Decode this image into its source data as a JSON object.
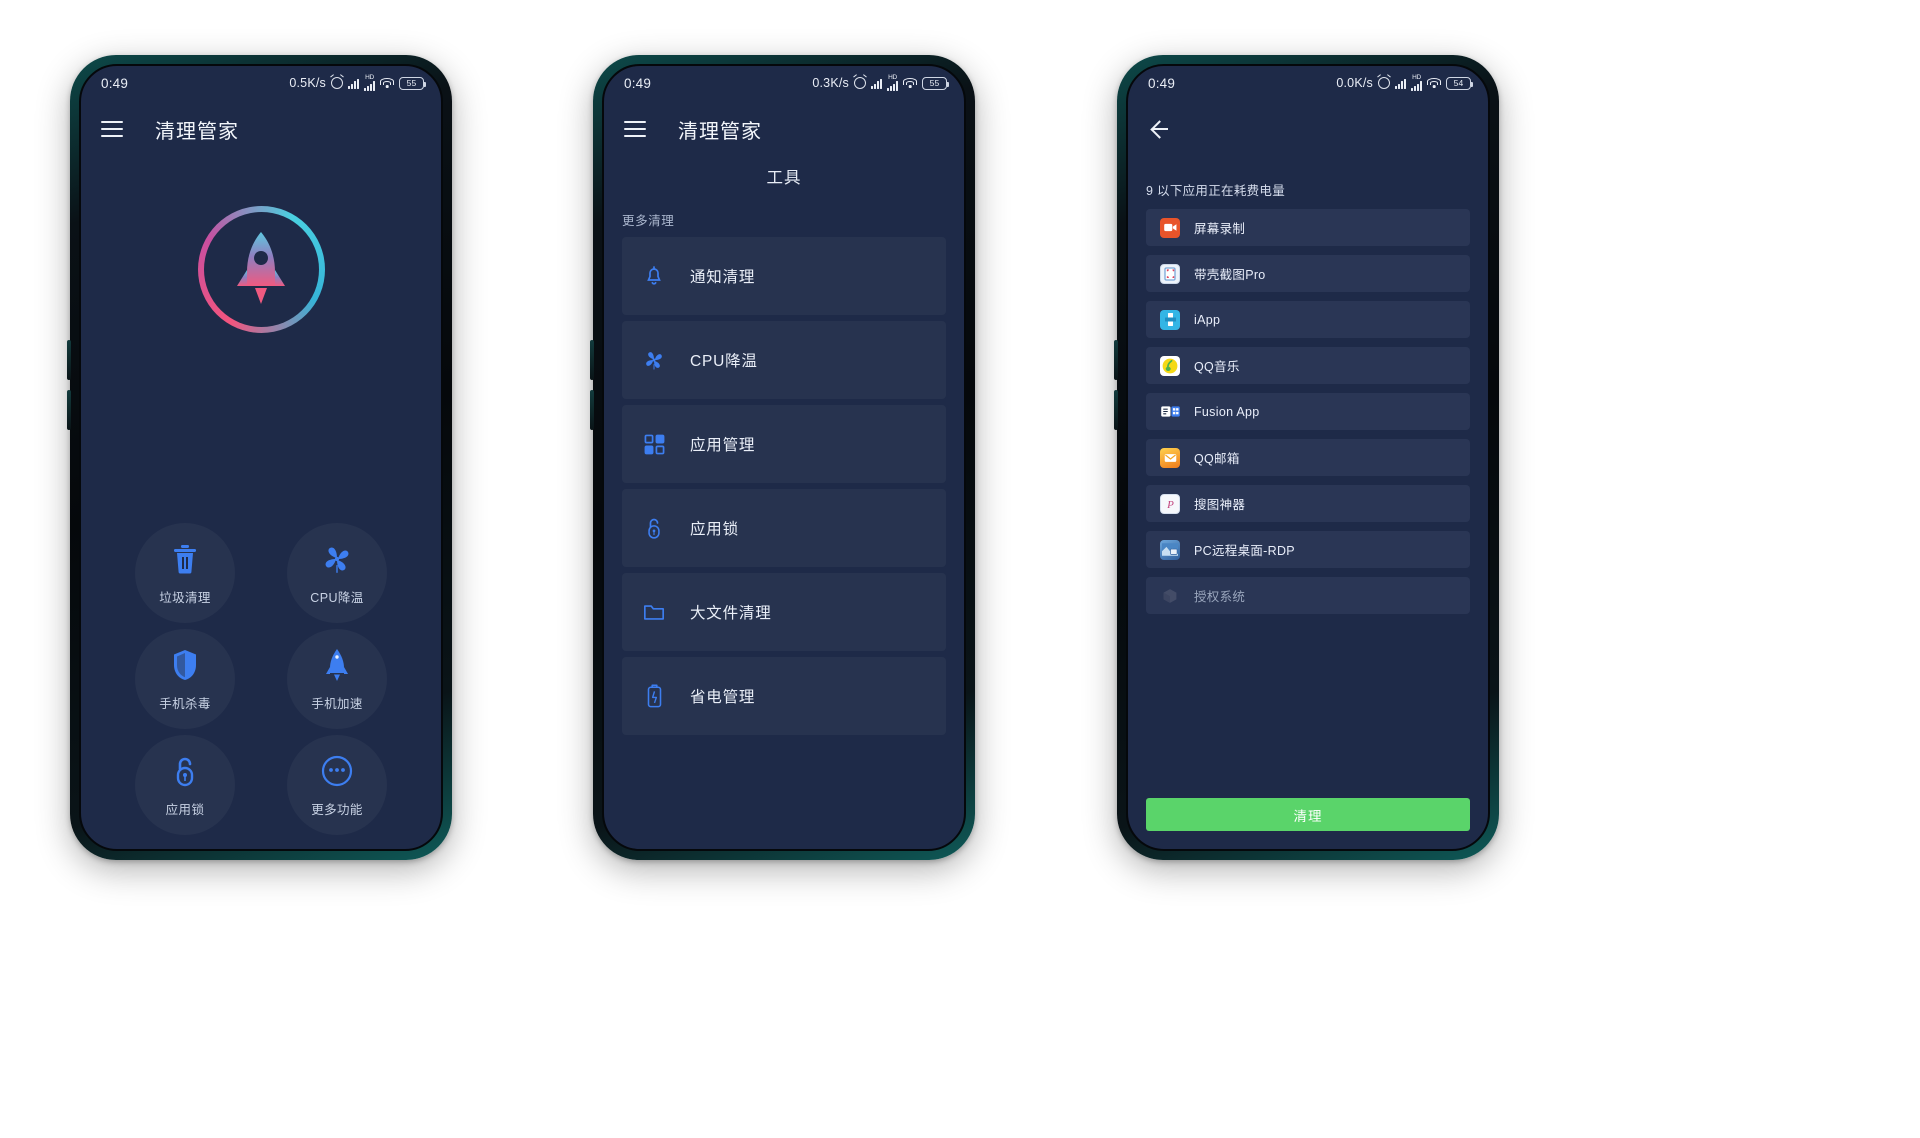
{
  "screen1": {
    "status": {
      "time": "0:49",
      "speed": "0.5K/s",
      "alarm": "alarm-icon",
      "signal1": "signal-bars-icon",
      "signal2": "signal-hd-icon",
      "wifi": "wifi-icon",
      "battery": "55"
    },
    "appbar": {
      "menu": "hamburger-icon",
      "title": "清理管家"
    },
    "hero": {
      "icon": "rocket-icon"
    },
    "tiles": [
      {
        "label": "垃圾清理",
        "icon": "trash-icon"
      },
      {
        "label": "CPU降温",
        "icon": "fan-icon"
      },
      {
        "label": "手机杀毒",
        "icon": "shield-icon"
      },
      {
        "label": "手机加速",
        "icon": "rocket-icon"
      },
      {
        "label": "应用锁",
        "icon": "lock-icon"
      },
      {
        "label": "更多功能",
        "icon": "more-dots-icon"
      }
    ]
  },
  "screen2": {
    "status": {
      "time": "0:49",
      "speed": "0.3K/s",
      "alarm": "alarm-icon",
      "wifi": "wifi-icon",
      "battery": "55"
    },
    "appbar": {
      "menu": "hamburger-icon",
      "title": "清理管家"
    },
    "page_title": "工具",
    "section_label": "更多清理",
    "tools": [
      {
        "label": "通知清理",
        "icon": "bell-icon"
      },
      {
        "label": "CPU降温",
        "icon": "fan-icon"
      },
      {
        "label": "应用管理",
        "icon": "apps-grid-icon"
      },
      {
        "label": "应用锁",
        "icon": "lock-icon"
      },
      {
        "label": "大文件清理",
        "icon": "folder-icon"
      },
      {
        "label": "省电管理",
        "icon": "battery-icon"
      }
    ]
  },
  "screen3": {
    "status": {
      "time": "0:49",
      "speed": "0.0K/s",
      "alarm": "alarm-icon",
      "wifi": "wifi-icon",
      "battery": "54"
    },
    "appbar": {
      "back": "back-arrow-icon"
    },
    "hint": "9 以下应用正在耗费电量",
    "apps": [
      {
        "name": "屏幕录制",
        "icon": "screen-recorder-icon",
        "bg": "#e8542a",
        "glyph": "▶"
      },
      {
        "name": "带壳截图Pro",
        "icon": "screenshot-pro-icon",
        "bg": "#f2f6fb",
        "glyph": "▣"
      },
      {
        "name": "iApp",
        "icon": "iapp-icon",
        "bg": "#33b5e5",
        "glyph": "i"
      },
      {
        "name": "QQ音乐",
        "icon": "qq-music-icon",
        "bg": "#ffffff",
        "glyph": "♪"
      },
      {
        "name": "Fusion App",
        "icon": "fusion-app-icon",
        "bg": "#1d2b45",
        "glyph": "▤"
      },
      {
        "name": "QQ邮箱",
        "icon": "qq-mail-icon",
        "bg": "#f5a623",
        "glyph": "✉"
      },
      {
        "name": "搜图神器",
        "icon": "image-search-icon",
        "bg": "#f6f8fc",
        "glyph": "P"
      },
      {
        "name": "PC远程桌面-RDP",
        "icon": "rdp-icon",
        "bg": "#4a79b5",
        "glyph": "▭"
      },
      {
        "name": "授权系统",
        "icon": "auth-system-icon",
        "bg": "#303c5c",
        "glyph": "◈",
        "dim": true
      }
    ],
    "clean_button": "清理"
  },
  "colors": {
    "screen_bg": "#1e2a48",
    "card_bg": "#27334f",
    "app_card_bg": "#2a3655",
    "accent_blue": "#3d7ef0",
    "clean_green": "#5ad46a"
  }
}
